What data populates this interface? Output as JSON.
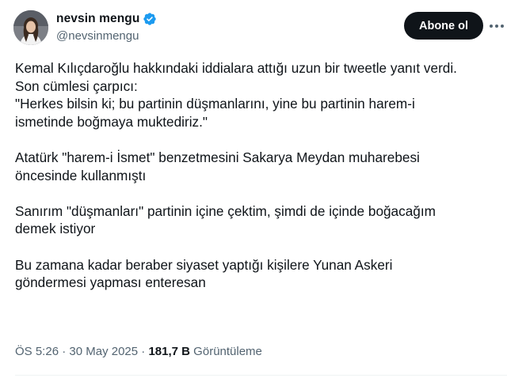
{
  "author": {
    "display_name": "nevsin mengu",
    "handle": "@nevsinmengu",
    "avatar_icon": "profile-photo",
    "verified_icon": "verified-badge-icon",
    "verified_color": "#1d9bf0"
  },
  "actions": {
    "follow_label": "Abone ol",
    "more_icon": "more-options-icon"
  },
  "tweet": {
    "paragraphs": [
      {
        "lines": [
          "Kemal Kılıçdaroğlu hakkındaki iddialara attığı uzun bir tweetle yanıt verdi.",
          "Son cümlesi çarpıcı:",
          "\"Herkes bilsin ki; bu partinin düşmanlarını, yine bu partinin harem-i",
          "ismetinde boğmaya muktediriz.\""
        ]
      },
      {
        "lines": [
          "Atatürk \"harem-i İsmet\" benzetmesini Sakarya Meydan muharebesi",
          "öncesinde kullanmıştı"
        ]
      },
      {
        "lines": [
          "Sanırım \"düşmanları\" partinin içine çektim, şimdi de içinde boğacağım",
          "demek istiyor"
        ]
      },
      {
        "lines": [
          "Bu zamana kadar beraber siyaset yaptığı kişilere Yunan Askeri",
          "göndermesi yapması enteresan"
        ]
      }
    ]
  },
  "meta": {
    "time": "ÖS 5:26",
    "separator": " · ",
    "date": "30 May 2025",
    "views_count": "181,7 B",
    "views_label": " Görüntüleme"
  }
}
